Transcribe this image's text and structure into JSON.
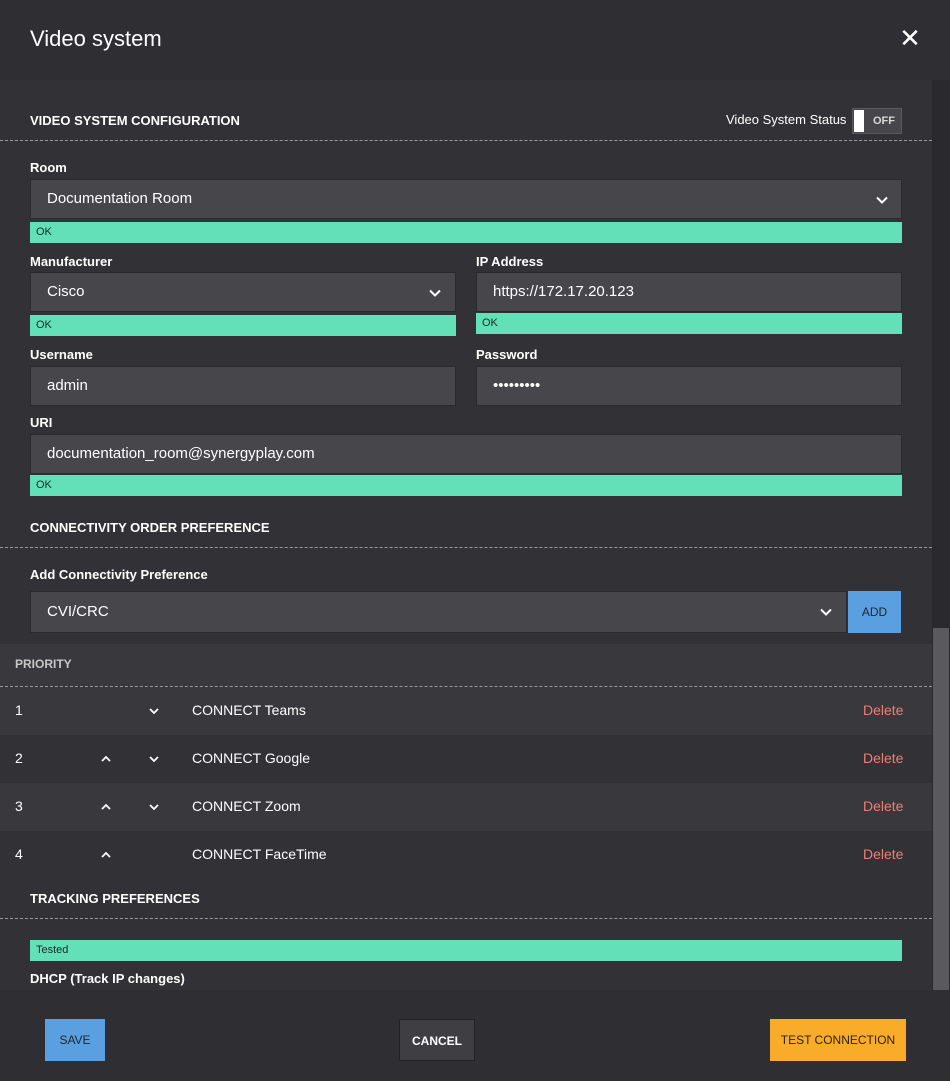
{
  "window": {
    "title": "Video system",
    "close_icon": "close-icon"
  },
  "config": {
    "section_title": "VIDEO SYSTEM CONFIGURATION",
    "status_label": "Video System Status",
    "status_toggle": "OFF",
    "room": {
      "label": "Room",
      "value": "Documentation Room",
      "status": "OK"
    },
    "manufacturer": {
      "label": "Manufacturer",
      "value": "Cisco",
      "status": "OK"
    },
    "ip": {
      "label": "IP Address",
      "value": "https://172.17.20.123",
      "status": "OK"
    },
    "username": {
      "label": "Username",
      "value": "admin"
    },
    "password": {
      "label": "Password",
      "value": "•••••••••"
    },
    "uri": {
      "label": "URI",
      "value": "documentation_room@synergyplay.com",
      "status": "OK"
    }
  },
  "connectivity": {
    "section_title": "CONNECTIVITY ORDER PREFERENCE",
    "add_label": "Add Connectivity Preference",
    "add_value": "CVI/CRC",
    "add_button": "ADD",
    "priority_header": "PRIORITY",
    "rows": [
      {
        "num": "1",
        "name": "CONNECT Teams",
        "delete": "Delete"
      },
      {
        "num": "2",
        "name": "CONNECT Google",
        "delete": "Delete"
      },
      {
        "num": "3",
        "name": "CONNECT Zoom",
        "delete": "Delete"
      },
      {
        "num": "4",
        "name": "CONNECT FaceTime",
        "delete": "Delete"
      }
    ]
  },
  "tracking": {
    "section_title": "TRACKING PREFERENCES",
    "status": "Tested",
    "dhcp_label": "DHCP (Track IP changes)"
  },
  "footer": {
    "save": "SAVE",
    "cancel": "CANCEL",
    "test": "TEST CONNECTION"
  },
  "colors": {
    "ok_green": "#63e0b8",
    "primary_blue": "#5aa0e0",
    "accent_orange": "#f9ab2a",
    "delete_red": "#ef7f6e"
  }
}
